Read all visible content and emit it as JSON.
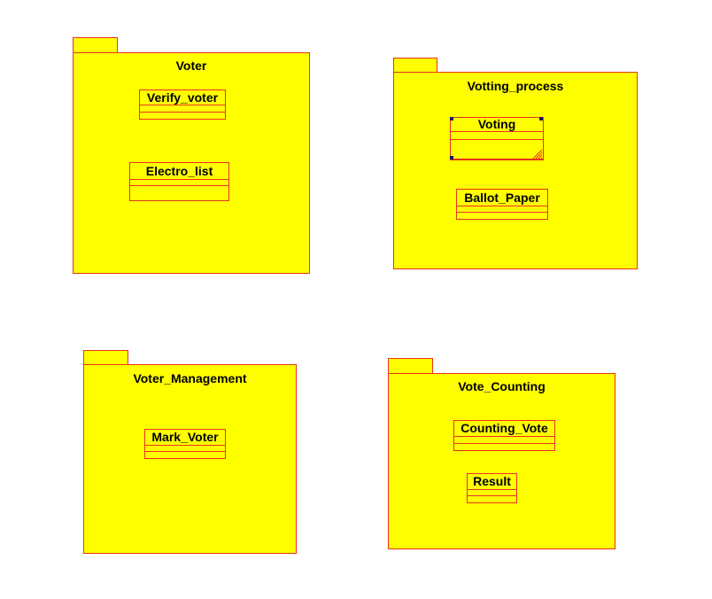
{
  "diagram": {
    "packages": [
      {
        "name": "Voter",
        "classes": [
          {
            "name": "Verify_voter"
          },
          {
            "name": "Electro_list"
          }
        ]
      },
      {
        "name": "Votting_process",
        "classes": [
          {
            "name": "Voting"
          },
          {
            "name": "Ballot_Paper"
          }
        ]
      },
      {
        "name": "Voter_Management",
        "classes": [
          {
            "name": "Mark_Voter"
          }
        ]
      },
      {
        "name": "Vote_Counting",
        "classes": [
          {
            "name": "Counting_Vote"
          },
          {
            "name": "Result"
          }
        ]
      }
    ],
    "colors": {
      "fill": "#ffff00",
      "border": "#e8341c",
      "text": "#000000",
      "selection_handle": "#1a1a66"
    },
    "selected_class": "Voting"
  }
}
